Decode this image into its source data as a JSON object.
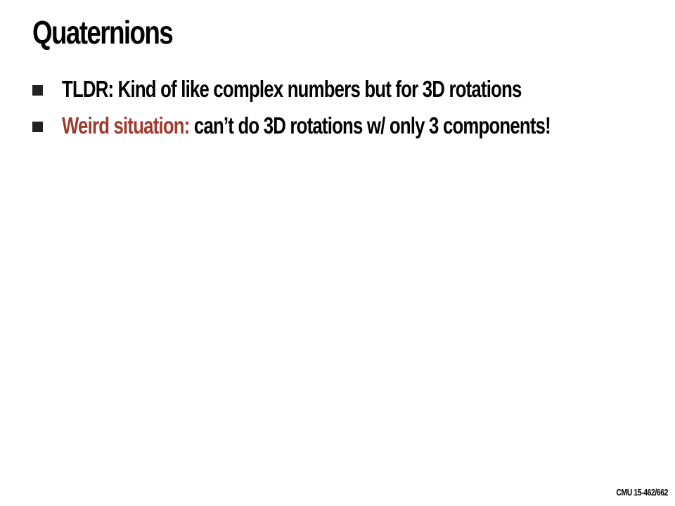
{
  "slide": {
    "title": "Quaternions",
    "bullets": [
      {
        "text": "TLDR: Kind of like complex numbers but for 3D rotations"
      },
      {
        "highlight": "Weird situation:",
        "text": " can’t do 3D rotations w/ only 3 components!"
      }
    ],
    "footer": "CMU 15-462/662"
  },
  "colors": {
    "highlight": "#9c3b2e",
    "text": "#000000",
    "bullet_marker": "#222222",
    "background": "#ffffff"
  },
  "icons": {
    "bullet": "square-bullet-icon"
  }
}
